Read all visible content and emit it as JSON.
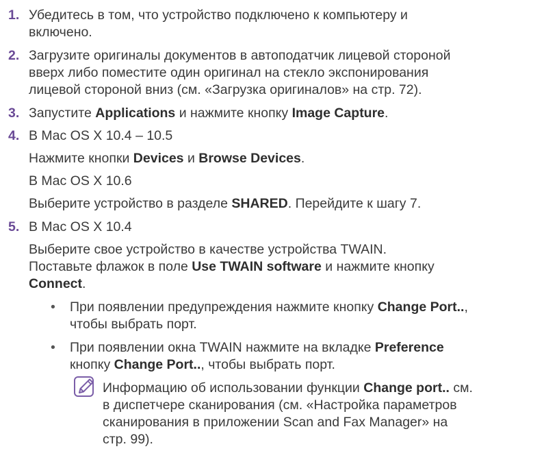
{
  "steps": [
    {
      "num": "1.",
      "lines": [
        [
          "Убедитесь в том, что устройство подключено к компьютеру и"
        ],
        [
          "включено."
        ]
      ]
    },
    {
      "num": "2.",
      "lines": [
        [
          "Загрузите оригиналы документов в автоподатчик лицевой стороной"
        ],
        [
          "вверх либо поместите один оригинал на стекло экспонирования"
        ],
        [
          "лицевой стороной вниз (см. «Загрузка оригиналов» на стр. 72)."
        ]
      ]
    },
    {
      "num": "3.",
      "pre": "Запустите ",
      "b1": "Applications",
      "mid": " и нажмите кнопку ",
      "b2": "Image Capture",
      "post": "."
    },
    {
      "num": "4.",
      "text": "В Mac OS X 10.4 – 10.5"
    },
    {
      "text_pre": "Нажмите кнопки ",
      "b1": "Devices",
      "mid": " и ",
      "b2": "Browse Devices",
      "post": "."
    },
    {
      "text": "В Mac OS X 10.6"
    },
    {
      "text_pre": "Выберите устройство в разделе ",
      "b1": "SHARED",
      "post": ". Перейдите к шагу 7."
    },
    {
      "num": "5.",
      "text": "В Mac OS X 10.4"
    },
    {
      "text": "Выберите свое устройство в качестве устройства TWAIN."
    },
    {
      "text_pre": "Поставьте флажок в поле ",
      "b1": "Use TWAIN software",
      "post": " и нажмите кнопку"
    },
    {
      "b1": "Connect",
      "post": "."
    }
  ],
  "bullets": [
    {
      "pre": "При появлении предупреждения нажмите кнопку ",
      "b": "Change Port..",
      "post": ",",
      "line2": "чтобы выбрать порт."
    },
    {
      "pre": "При появлении окна TWAIN нажмите на вкладке ",
      "b": "Preference",
      "post": "",
      "line2_pre": "кнопку ",
      "line2_b": "Change Port..",
      "line2_post": ", чтобы выбрать порт."
    }
  ],
  "bullet_glyph": "•",
  "note": {
    "icon": "note-pencil-icon",
    "l1_pre": "Информацию об использовании функции ",
    "l1_b": "Change port..",
    "l1_post": " см.",
    "l2": "в диспетчере сканирования (см. «Настройка параметров",
    "l3": "сканирования в приложении Scan and Fax Manager» на",
    "l4": "стр. 99)."
  },
  "colors": {
    "text": "#3a3a3a",
    "number": "#6a4a96",
    "icon": "#7b5ea8"
  }
}
